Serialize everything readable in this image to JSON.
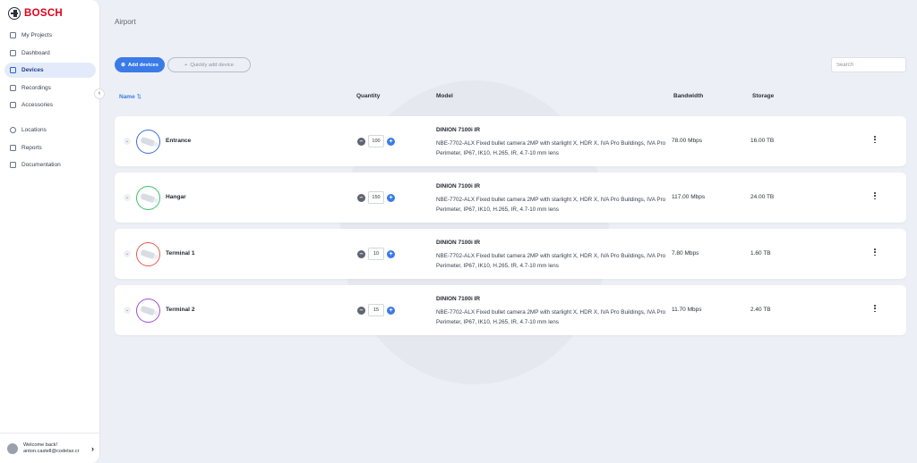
{
  "brand": {
    "name": "BOSCH",
    "color": "#e2001a"
  },
  "sidebar": {
    "items": [
      {
        "label": "My Projects",
        "icon": "list-icon"
      },
      {
        "label": "Dashboard",
        "icon": "grid-icon"
      },
      {
        "label": "Devices",
        "icon": "camera-icon",
        "active": true
      },
      {
        "label": "Recordings",
        "icon": "recordings-icon"
      },
      {
        "label": "Accessories",
        "icon": "accessories-icon"
      },
      {
        "label": "Locations",
        "icon": "location-pin-icon"
      },
      {
        "label": "Reports",
        "icon": "report-icon"
      },
      {
        "label": "Documentation",
        "icon": "book-icon"
      }
    ],
    "user": {
      "welcome": "Welcome back!",
      "email": "anton.castell@codelax.cr"
    }
  },
  "page": {
    "title": "Airport"
  },
  "toolbar": {
    "add_label": "Add devices",
    "quick_label": "Quickly add device",
    "search_placeholder": "Search"
  },
  "table": {
    "headers": {
      "name": "Name",
      "quantity": "Quantity",
      "model": "Model",
      "bandwidth": "Bandwidth",
      "storage": "Storage"
    },
    "rows": [
      {
        "name": "Entrance",
        "color": "#3b6fd8",
        "quantity": "100",
        "model_title": "DINION 7100i IR",
        "model_desc": "NBE-7702-ALX Fixed bullet camera 2MP with starlight X, HDR X, IVA Pro Buildings, IVA Pro Perimeter, IP67, IK10, H.265, IR, 4.7-10 mm lens",
        "bandwidth": "78.00 Mbps",
        "storage": "16.00 TB"
      },
      {
        "name": "Hangar",
        "color": "#3fbf6a",
        "quantity": "150",
        "model_title": "DINION 7100i IR",
        "model_desc": "NBE-7702-ALX Fixed bullet camera 2MP with starlight X, HDR X, IVA Pro Buildings, IVA Pro Perimeter, IP67, IK10, H.265, IR, 4.7-10 mm lens",
        "bandwidth": "117.00 Mbps",
        "storage": "24.00 TB"
      },
      {
        "name": "Terminal 1",
        "color": "#e25b4e",
        "quantity": "10",
        "model_title": "DINION 7100i IR",
        "model_desc": "NBE-7702-ALX Fixed bullet camera 2MP with starlight X, HDR X, IVA Pro Buildings, IVA Pro Perimeter, IP67, IK10, H.265, IR, 4.7-10 mm lens",
        "bandwidth": "7.80 Mbps",
        "storage": "1.60 TB"
      },
      {
        "name": "Terminal 2",
        "color": "#9b4fd6",
        "quantity": "15",
        "model_title": "DINION 7100i IR",
        "model_desc": "NBE-7702-ALX Fixed bullet camera 2MP with starlight X, HDR X, IVA Pro Buildings, IVA Pro Perimeter, IP67, IK10, H.265, IR, 4.7-10 mm lens",
        "bandwidth": "11.70 Mbps",
        "storage": "2.40 TB"
      }
    ]
  }
}
